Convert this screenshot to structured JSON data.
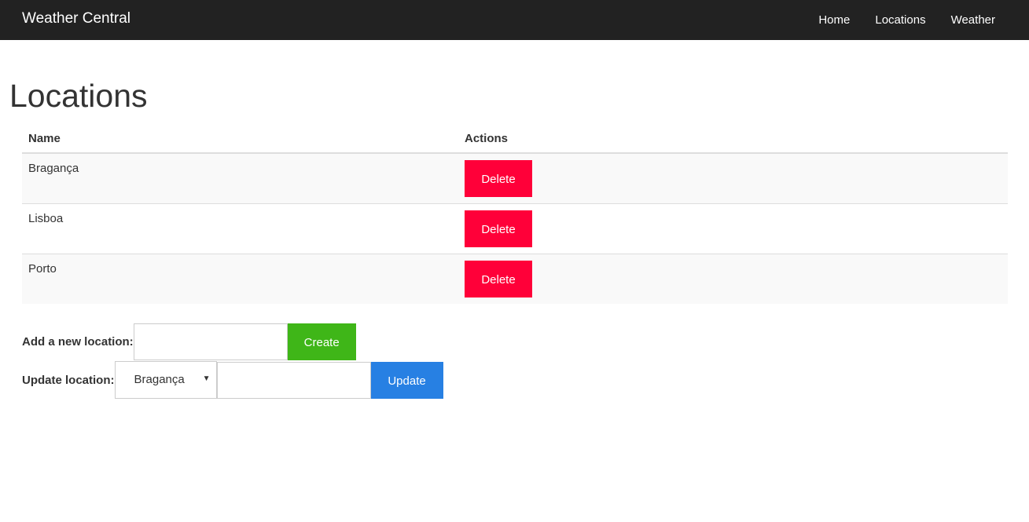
{
  "navbar": {
    "brand": "Weather Central",
    "links": [
      "Home",
      "Locations",
      "Weather"
    ]
  },
  "page": {
    "title": "Locations"
  },
  "table": {
    "headers": {
      "name": "Name",
      "actions": "Actions"
    },
    "rows": [
      {
        "name": "Bragança",
        "action": "Delete"
      },
      {
        "name": "Lisboa",
        "action": "Delete"
      },
      {
        "name": "Porto",
        "action": "Delete"
      }
    ]
  },
  "add_form": {
    "label": "Add a new location:",
    "input_value": "",
    "button": "Create"
  },
  "update_form": {
    "label": "Update location:",
    "selected": "Bragança",
    "input_value": "",
    "button": "Update"
  },
  "colors": {
    "navbar": "#222222",
    "delete": "#ff0039",
    "create": "#3fb618",
    "update": "#2780e3"
  }
}
